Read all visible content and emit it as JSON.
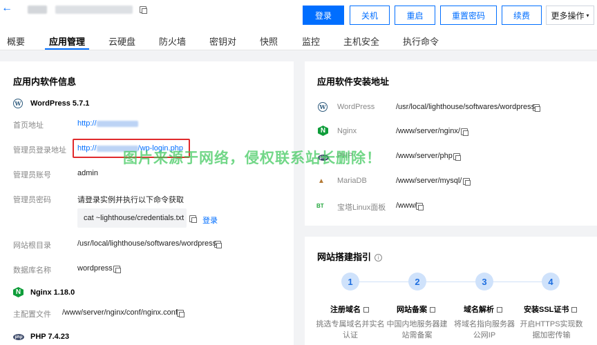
{
  "header": {
    "back_icon": "arrow-left-icon",
    "buttons": {
      "login": "登录",
      "shutdown": "关机",
      "restart": "重启",
      "reset_password": "重置密码",
      "renew": "续费",
      "more": "更多操作"
    }
  },
  "tabs": [
    "概要",
    "应用管理",
    "云硬盘",
    "防火墙",
    "密钥对",
    "快照",
    "监控",
    "主机安全",
    "执行命令"
  ],
  "active_tab": "应用管理",
  "software_info": {
    "title": "应用内软件信息",
    "wordpress": {
      "name": "WordPress 5.7.1",
      "home_label": "首页地址",
      "home_value": "http://",
      "admin_login_label": "管理员登录地址",
      "admin_login_prefix": "http://",
      "admin_login_suffix": "/wp-login.php",
      "admin_account_label": "管理员账号",
      "admin_account_value": "admin",
      "admin_password_label": "管理员密码",
      "admin_password_value": "请登录实例并执行以下命令获取",
      "command": "cat ~lighthouse/credentials.txt",
      "command_login": "登录",
      "site_root_label": "网站根目录",
      "site_root_value": "/usr/local/lighthouse/softwares/wordpress",
      "db_name_label": "数据库名称",
      "db_name_value": "wordpress"
    },
    "nginx": {
      "name": "Nginx 1.18.0",
      "config_label": "主配置文件",
      "config_value": "/www/server/nginx/conf/nginx.conf"
    },
    "php": {
      "name": "PHP 7.4.23"
    }
  },
  "install_paths": {
    "title": "应用软件安装地址",
    "items": [
      {
        "name": "WordPress",
        "path": "/usr/local/lighthouse/softwares/wordpress",
        "icon": "wordpress-icon"
      },
      {
        "name": "Nginx",
        "path": "/www/server/nginx/",
        "icon": "nginx-icon"
      },
      {
        "name": "PHP",
        "path": "/www/server/php",
        "icon": "php-icon"
      },
      {
        "name": "MariaDB",
        "path": "/www/server/mysql/",
        "icon": "mariadb-icon"
      },
      {
        "name": "宝塔Linux面板",
        "path": "/www/",
        "icon": "bt-panel-icon"
      }
    ]
  },
  "guide": {
    "title": "网站搭建指引",
    "steps": [
      {
        "num": "1",
        "title": "注册域名",
        "desc": "挑选专属域名并实名认证"
      },
      {
        "num": "2",
        "title": "网站备案",
        "desc": "中国内地服务器建站需备案"
      },
      {
        "num": "3",
        "title": "域名解析",
        "desc": "将域名指向服务器公网IP"
      },
      {
        "num": "4",
        "title": "安装SSL证书",
        "desc": "开启HTTPS实现数据加密传输"
      }
    ]
  },
  "watermark": "图片来源于网络，侵权联系站长删除！",
  "colors": {
    "accent": "#006eff",
    "highlight_box": "#e0292b",
    "watermark": "#3cc85a"
  }
}
